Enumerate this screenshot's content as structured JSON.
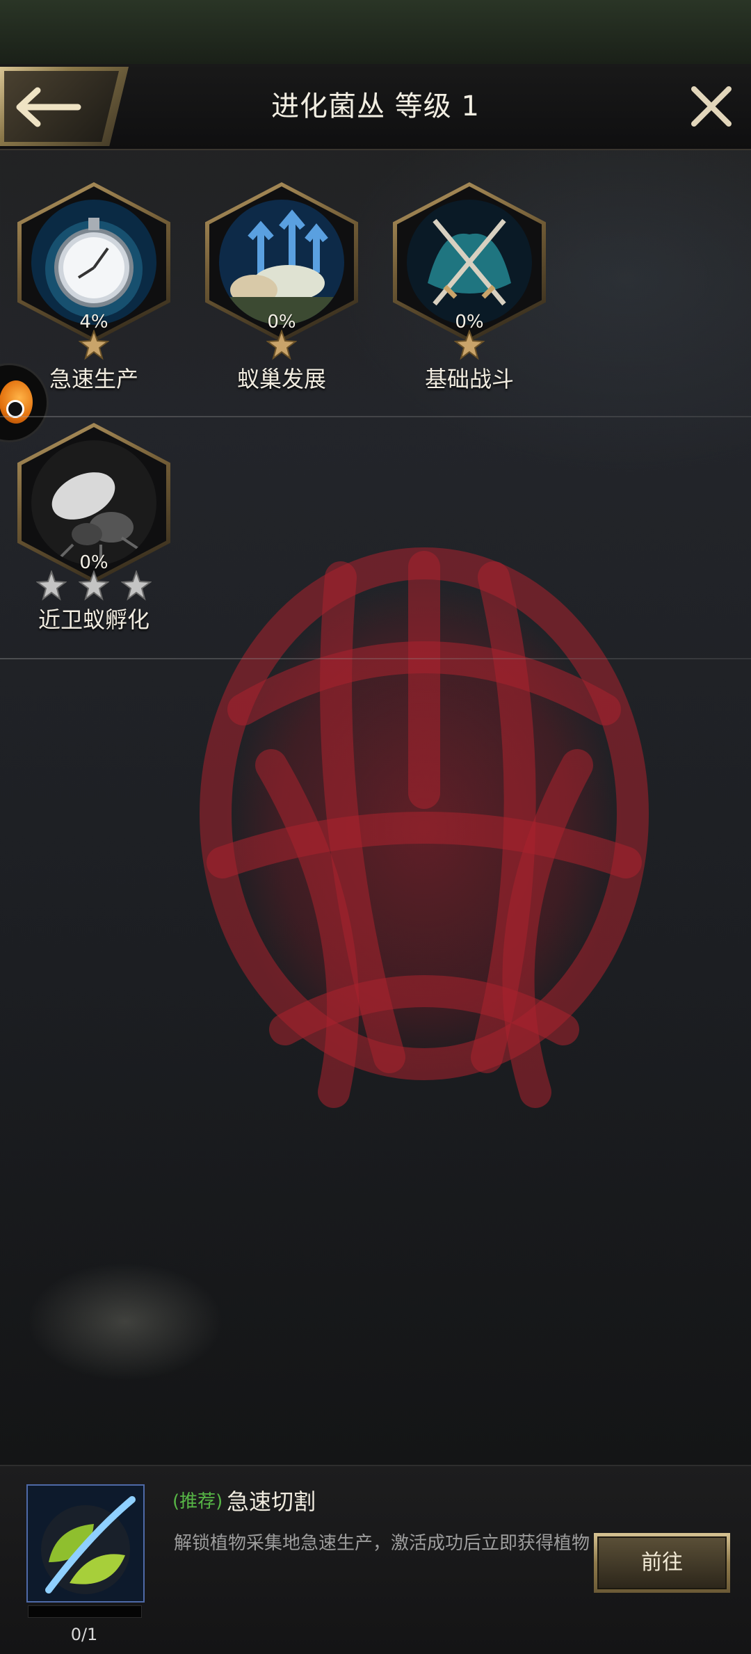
{
  "header": {
    "title": "进化菌丛 等级 1",
    "back_icon": "arrow-left-icon",
    "close_icon": "close-icon"
  },
  "skills": [
    {
      "name": "急速生产",
      "percent": "4%",
      "stars": 1,
      "star_color": "#c9a46a",
      "icon": "stopwatch-icon"
    },
    {
      "name": "蚁巢发展",
      "percent": "0%",
      "stars": 1,
      "star_color": "#c9a46a",
      "icon": "colony-growth-icon"
    },
    {
      "name": "基础战斗",
      "percent": "0%",
      "stars": 1,
      "star_color": "#c9a46a",
      "icon": "crossed-swords-icon"
    },
    {
      "name": "近卫蚁孵化",
      "percent": "0%",
      "stars": 3,
      "star_color": "#bcbcbc",
      "icon": "guard-ant-hatch-icon"
    }
  ],
  "task": {
    "tag": "(推荐)",
    "title": "急速切割",
    "description": "解锁植物采集地急速生产，激活成功后立即获得植物",
    "progress": "0/1",
    "progress_value": 0,
    "button_label": "前往",
    "icon": "leaf-cut-icon"
  },
  "colors": {
    "gold": "#c9a46a",
    "recommend_green": "#57b646"
  }
}
